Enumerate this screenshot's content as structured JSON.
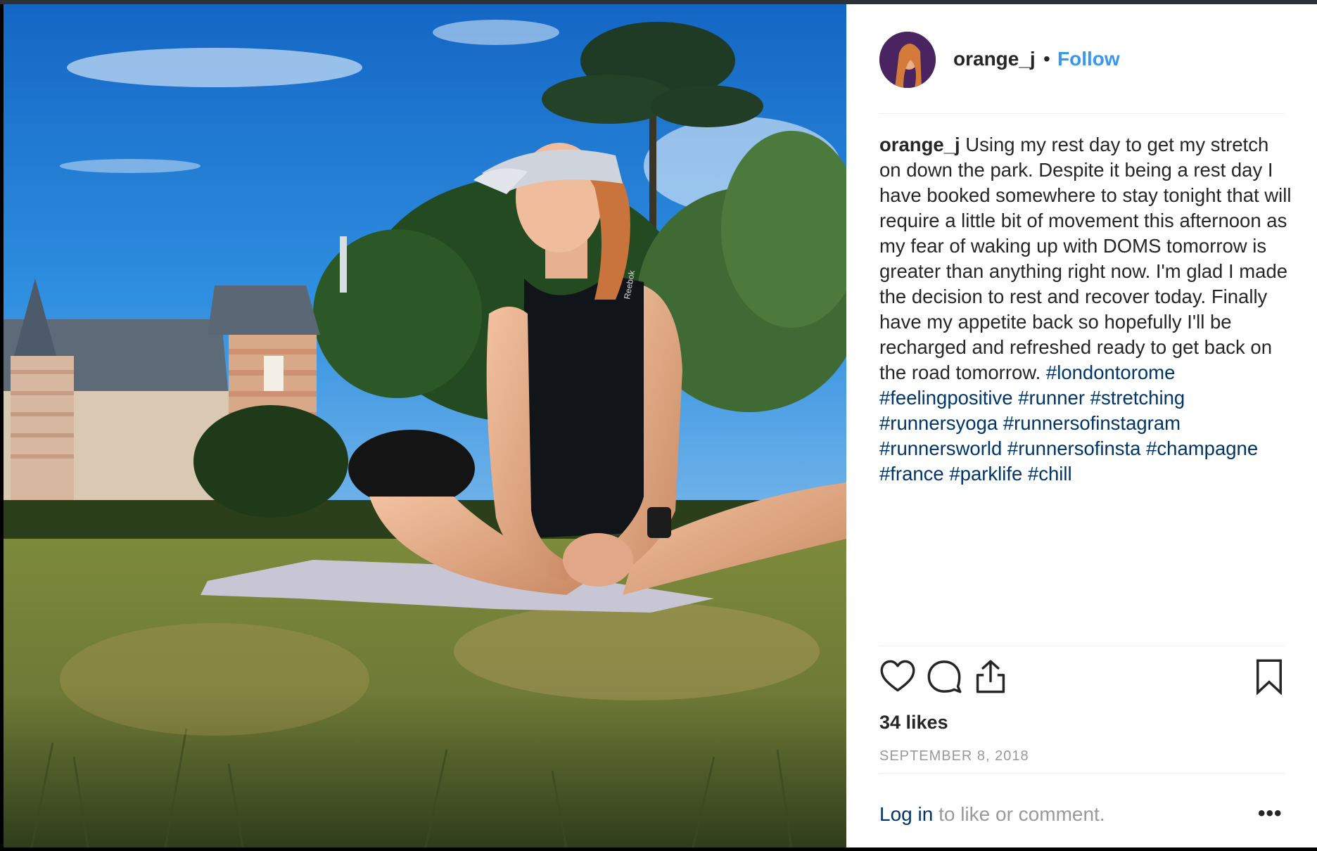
{
  "post": {
    "username": "orange_j",
    "separator": "•",
    "follow_label": "Follow",
    "caption_text": "Using my rest day to get my stretch on down the park. Despite it being a rest day I have booked somewhere to stay tonight that will require a little bit of movement this afternoon as my fear of waking up with DOMS tomorrow is greater than anything right now. I'm glad I made the decision to rest and recover today. Finally have my appetite back so hopefully I'll be recharged and refreshed ready to get back on the road tomorrow.",
    "hashtags": [
      "#londontorome",
      "#feelingpositive",
      "#runner",
      "#stretching",
      "#runnersyoga",
      "#runnersofinstagram",
      "#runnersworld",
      "#runnersofinsta",
      "#champagne",
      "#france",
      "#parklife",
      "#chill"
    ],
    "likes": "34 likes",
    "date": "SEPTEMBER 8, 2018",
    "login_link": "Log in",
    "login_text": " to like or comment.",
    "more_label": "•••"
  },
  "icons": {
    "like": "heart-icon",
    "comment": "comment-icon",
    "share": "share-icon",
    "save": "bookmark-icon",
    "more": "more-options-icon"
  },
  "photo": {
    "shirt_brand": "Reebok"
  },
  "colors": {
    "link_blue": "#3897f0",
    "hashtag_blue": "#003569",
    "text": "#262626",
    "muted": "#999999",
    "sky": "#1f7fd6"
  }
}
